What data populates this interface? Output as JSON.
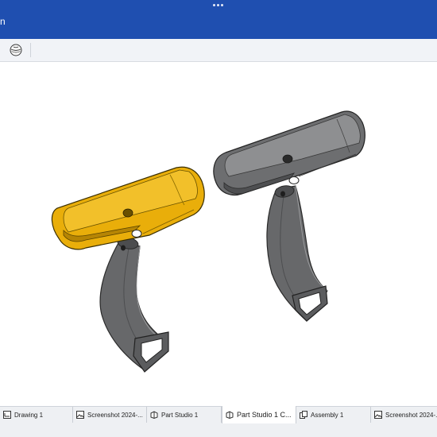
{
  "header": {
    "title_fragment": "n"
  },
  "toolbar": {
    "view_cube": "view-orientation-sphere"
  },
  "tabs": [
    {
      "label": "Drawing 1",
      "icon": "drawing-icon",
      "active": false
    },
    {
      "label": "Screenshot 2024-...",
      "icon": "image-icon",
      "active": false
    },
    {
      "label": "Part Studio 1",
      "icon": "part-studio-icon",
      "active": false
    },
    {
      "label": "Part Studio 1 C...",
      "icon": "part-studio-icon",
      "active": true
    },
    {
      "label": "Assembly 1",
      "icon": "assembly-icon",
      "active": false
    },
    {
      "label": "Screenshot 2024-...",
      "icon": "image-icon",
      "active": false
    }
  ],
  "colors": {
    "header": "#1f4fb0",
    "selected_part": "#e9ae0a",
    "part_grey": "#6a6b6d"
  }
}
